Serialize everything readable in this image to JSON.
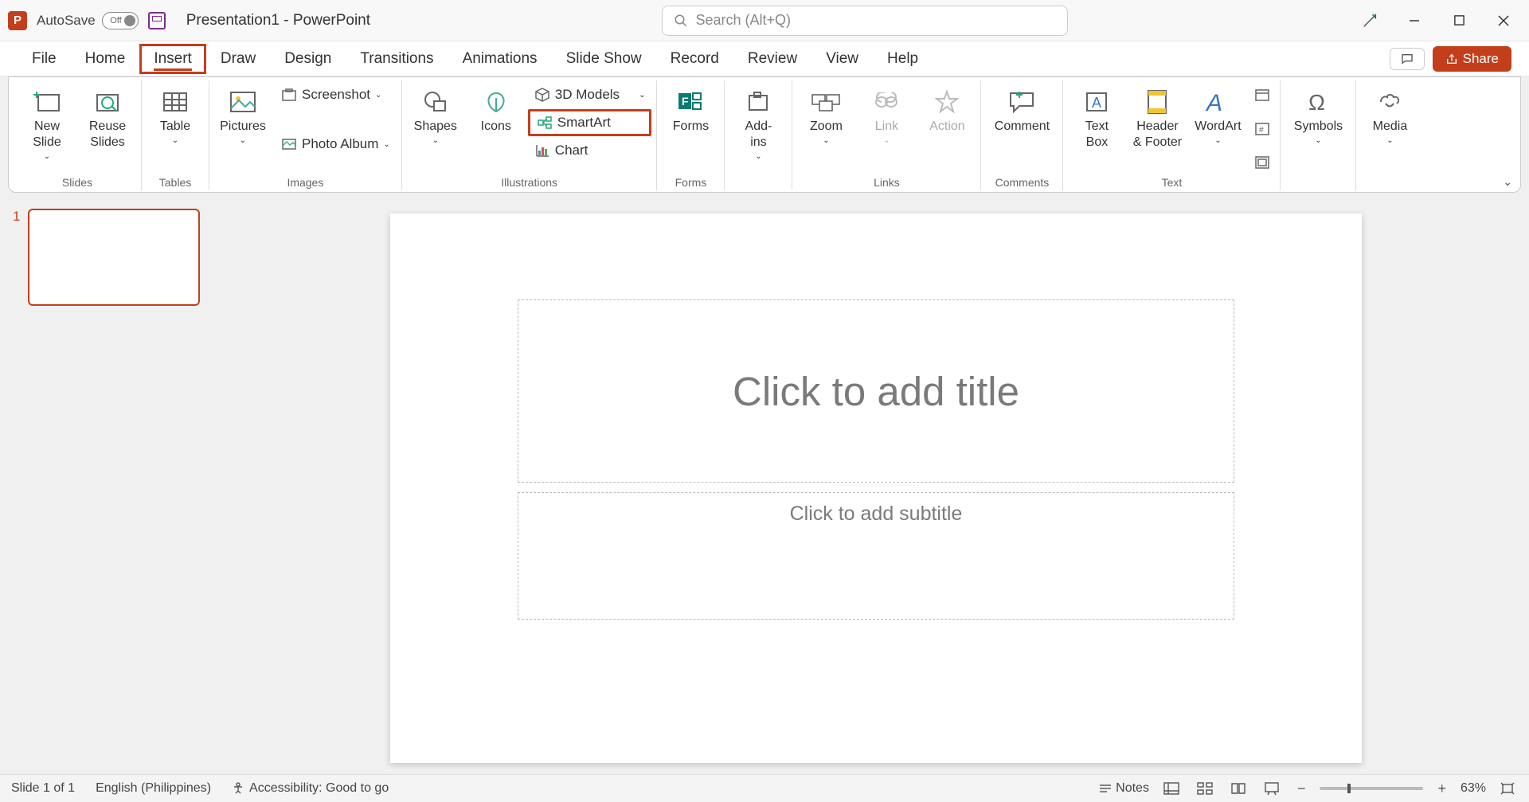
{
  "titlebar": {
    "autosave_label": "AutoSave",
    "autosave_state": "Off",
    "doc_title": "Presentation1  -  PowerPoint",
    "search_placeholder": "Search (Alt+Q)"
  },
  "tabs": {
    "items": [
      "File",
      "Home",
      "Insert",
      "Draw",
      "Design",
      "Transitions",
      "Animations",
      "Slide Show",
      "Record",
      "Review",
      "View",
      "Help"
    ],
    "active": "Insert",
    "share_label": "Share"
  },
  "ribbon": {
    "groups": {
      "slides": {
        "label": "Slides",
        "new_slide": "New\nSlide",
        "reuse": "Reuse\nSlides"
      },
      "tables": {
        "label": "Tables",
        "table": "Table"
      },
      "images": {
        "label": "Images",
        "pictures": "Pictures",
        "screenshot": "Screenshot",
        "photo_album": "Photo Album"
      },
      "illustrations": {
        "label": "Illustrations",
        "shapes": "Shapes",
        "icons": "Icons",
        "models": "3D Models",
        "smartart": "SmartArt",
        "chart": "Chart"
      },
      "forms": {
        "label": "Forms",
        "forms": "Forms"
      },
      "addins": {
        "label": "",
        "addins": "Add-\nins"
      },
      "links": {
        "label": "Links",
        "zoom": "Zoom",
        "link": "Link",
        "action": "Action"
      },
      "comments": {
        "label": "Comments",
        "comment": "Comment"
      },
      "text": {
        "label": "Text",
        "textbox": "Text\nBox",
        "header": "Header\n& Footer",
        "wordart": "WordArt"
      },
      "symbols": {
        "label": "",
        "symbols": "Symbols"
      },
      "media": {
        "label": "",
        "media": "Media"
      }
    }
  },
  "thumbnails": {
    "slide1_num": "1"
  },
  "slide": {
    "title_placeholder": "Click to add title",
    "subtitle_placeholder": "Click to add subtitle"
  },
  "statusbar": {
    "slide_info": "Slide 1 of 1",
    "language": "English (Philippines)",
    "accessibility": "Accessibility: Good to go",
    "notes": "Notes",
    "zoom_pct": "63%"
  }
}
